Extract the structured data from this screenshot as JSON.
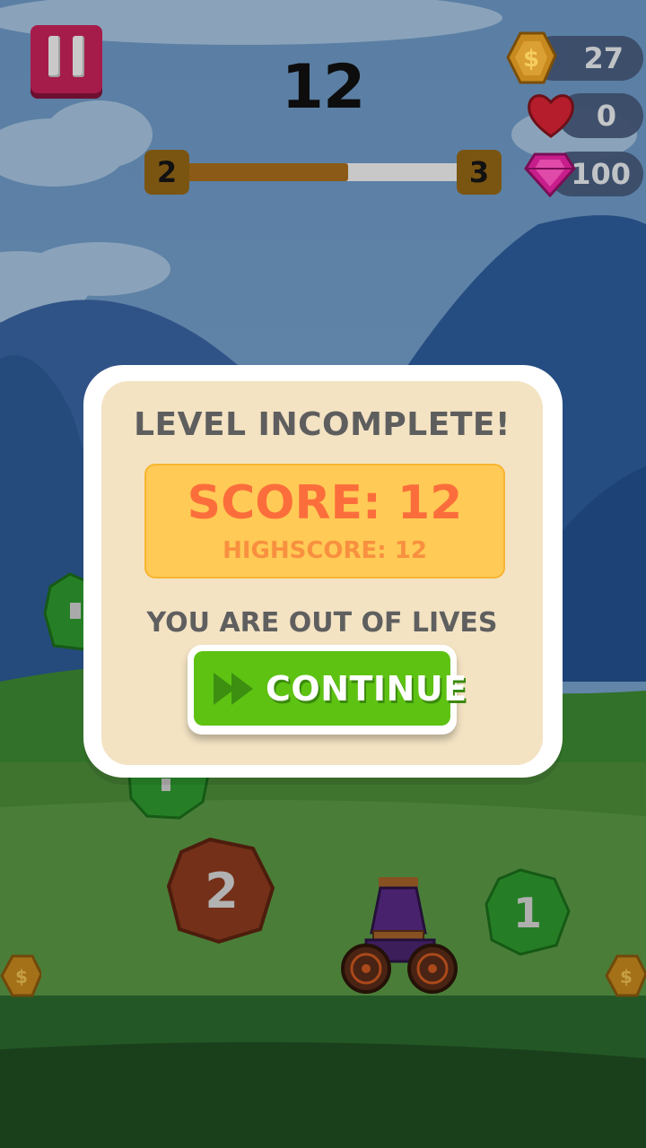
{
  "hud": {
    "score": "12",
    "level_current": "2",
    "level_next": "3",
    "level_progress": 0.58,
    "coins": "27",
    "lives": "0",
    "gems": "100"
  },
  "modal": {
    "title": "LEVEL INCOMPLETE!",
    "score_line": "SCORE: 12",
    "highscore_line": "HIGHSCORE: 12",
    "message": "YOU ARE OUT OF LIVES",
    "continue_label": "CONTINUE"
  },
  "scene": {
    "rocks": [
      {
        "name": "green-rock",
        "label": "1"
      },
      {
        "name": "brown-rock",
        "label": "2"
      },
      {
        "name": "green-rock",
        "label": "1"
      }
    ]
  },
  "colors": {
    "continue_green": "#5ec213",
    "score_orange": "#fb6e3c",
    "score_box": "#ffca55",
    "pause_red": "#a51c4b"
  }
}
